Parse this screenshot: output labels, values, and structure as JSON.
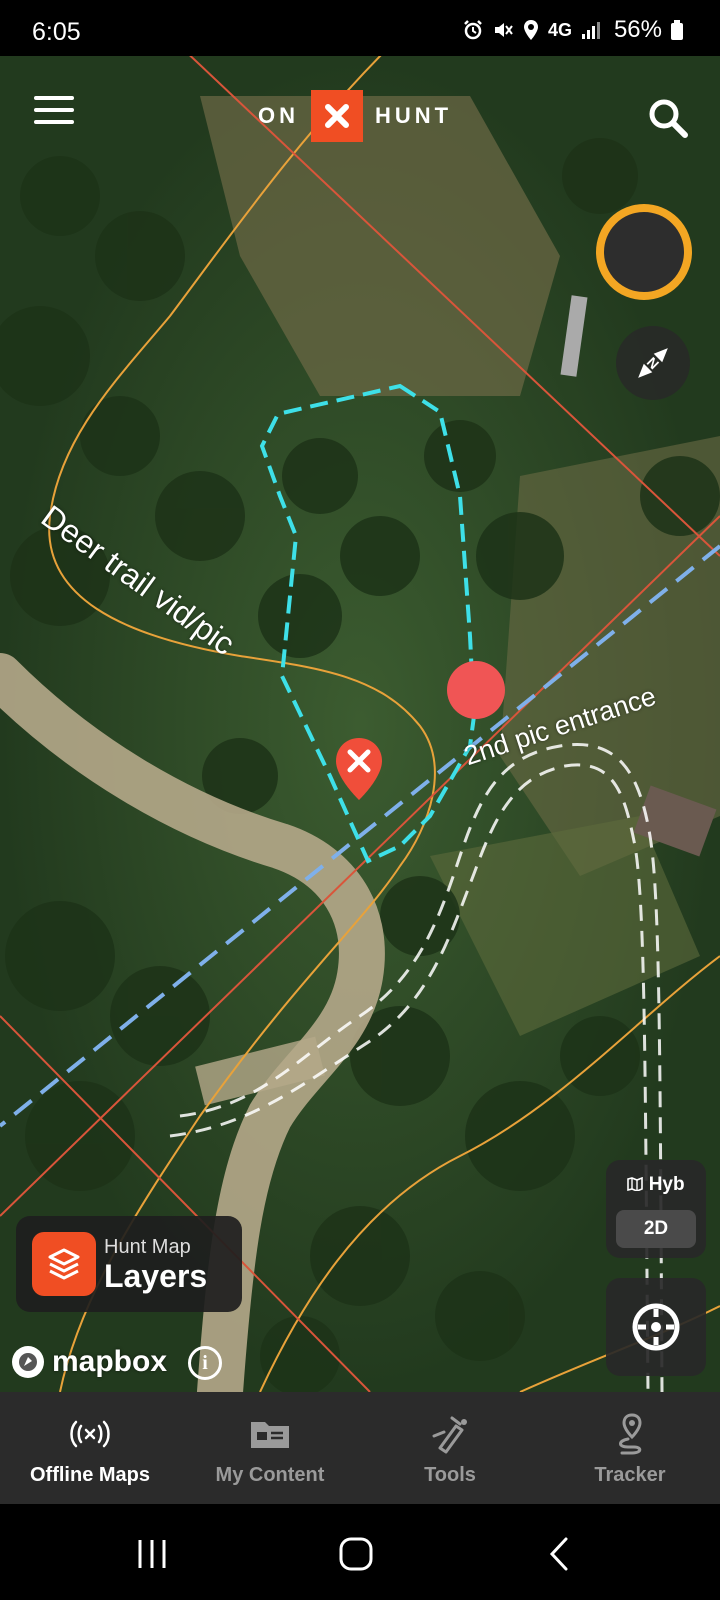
{
  "status_bar": {
    "time": "6:05",
    "network": "4G",
    "battery": "56%"
  },
  "header": {
    "logo_left": "ON",
    "logo_right": "HUNT",
    "icons": [
      "menu-icon",
      "search-icon"
    ]
  },
  "map": {
    "labels": {
      "deer_trail": "Deer trail vid/pic",
      "entrance": "2nd pic entrance"
    },
    "colors": {
      "boundary_orange": "#e8a23a",
      "property_red": "#d9553a",
      "track_cyan": "#3ee0e8",
      "road_blue": "#7fb0ea",
      "marker_red": "#f04e3a"
    },
    "layer_toggle": {
      "mode": "Hyb",
      "view": "2D"
    },
    "layers_button": {
      "subtitle": "Hunt Map",
      "title": "Layers"
    },
    "attribution": "mapbox",
    "info": "i"
  },
  "bottom_nav": {
    "items": [
      {
        "label": "Offline Maps",
        "icon": "offline-maps-icon",
        "active": true
      },
      {
        "label": "My Content",
        "icon": "my-content-icon",
        "active": false
      },
      {
        "label": "Tools",
        "icon": "tools-icon",
        "active": false
      },
      {
        "label": "Tracker",
        "icon": "tracker-icon",
        "active": false
      }
    ]
  }
}
